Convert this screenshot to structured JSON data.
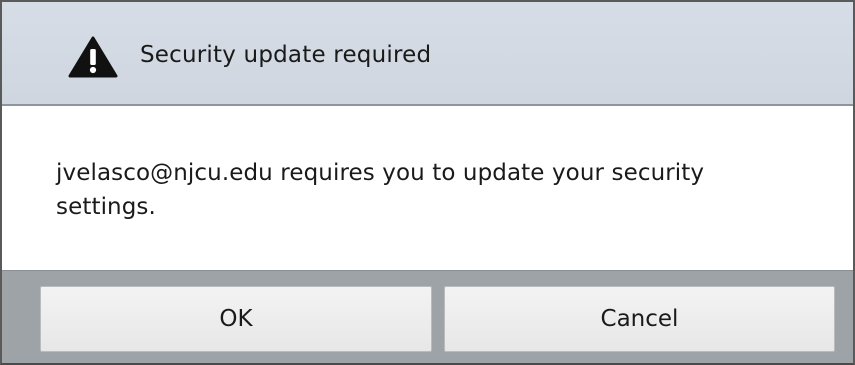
{
  "dialog": {
    "title": "Security update required",
    "icon": "warning-icon",
    "message": "jvelasco@njcu.edu requires you to update your security settings.",
    "buttons": {
      "ok_label": "OK",
      "cancel_label": "Cancel"
    }
  },
  "colors": {
    "title_bar": "#d3dae3",
    "button_bar": "#9ea3a8",
    "button_face": "#eeeeee",
    "text": "#1a1a1a"
  }
}
